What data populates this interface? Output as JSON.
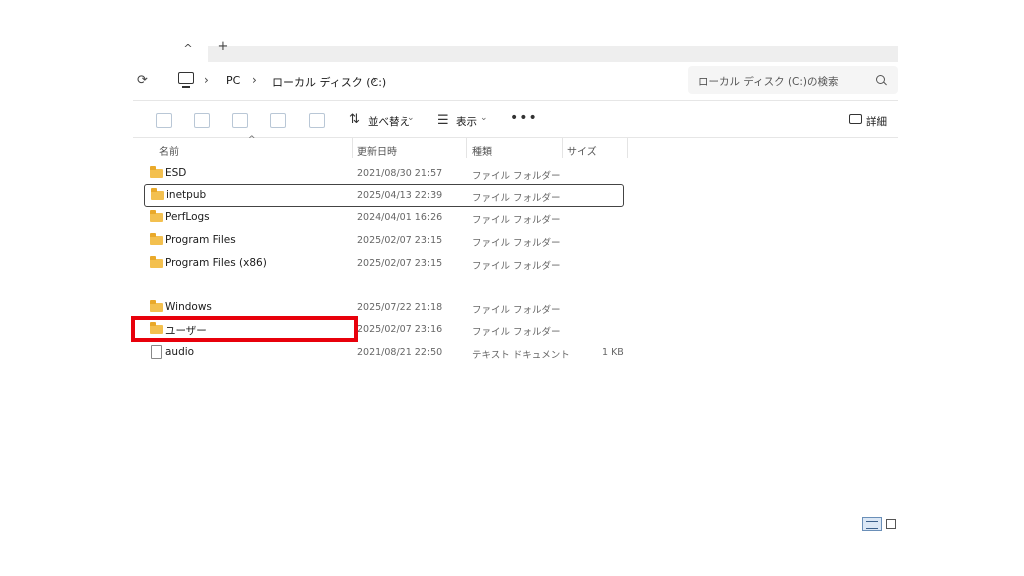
{
  "tab": {
    "close_glyph": "^",
    "new_glyph": "+"
  },
  "address": {
    "breadcrumbs": [
      "PC",
      "ローカル ディスク (C:)"
    ],
    "chevron": "›",
    "search_placeholder": "ローカル ディスク (C:)の検索"
  },
  "toolbar": {
    "sort_label": "並べ替え",
    "view_label": "表示",
    "more_glyph": "•••",
    "details_label": "詳細",
    "dropdown_glyph": "⌄"
  },
  "columns": {
    "name": "名前",
    "date": "更新日時",
    "type": "種類",
    "size": "サイズ"
  },
  "files": [
    {
      "name": "ESD",
      "date": "2021/08/30 21:57",
      "type": "ファイル フォルダー",
      "size": "",
      "icon": "folder-icon"
    },
    {
      "name": "inetpub",
      "date": "2025/04/13 22:39",
      "type": "ファイル フォルダー",
      "size": "",
      "icon": "folder-icon",
      "selected": true
    },
    {
      "name": "PerfLogs",
      "date": "2024/04/01 16:26",
      "type": "ファイル フォルダー",
      "size": "",
      "icon": "folder-icon"
    },
    {
      "name": "Program Files",
      "date": "2025/02/07 23:15",
      "type": "ファイル フォルダー",
      "size": "",
      "icon": "folder-icon"
    },
    {
      "name": "Program Files (x86)",
      "date": "2025/02/07 23:15",
      "type": "ファイル フォルダー",
      "size": "",
      "icon": "folder-icon"
    },
    {
      "name": "Windows",
      "date": "2025/07/22 21:18",
      "type": "ファイル フォルダー",
      "size": "",
      "icon": "folder-icon"
    },
    {
      "name": "ユーザー",
      "date": "2025/02/07 23:16",
      "type": "ファイル フォルダー",
      "size": "",
      "icon": "folder-icon",
      "highlighted": true
    },
    {
      "name": "audio",
      "date": "2021/08/21 22:50",
      "type": "テキスト ドキュメント",
      "size": "1 KB",
      "icon": "text-document-icon"
    }
  ],
  "colors": {
    "highlight": "#e8000b",
    "folder": "#f3c04f"
  }
}
